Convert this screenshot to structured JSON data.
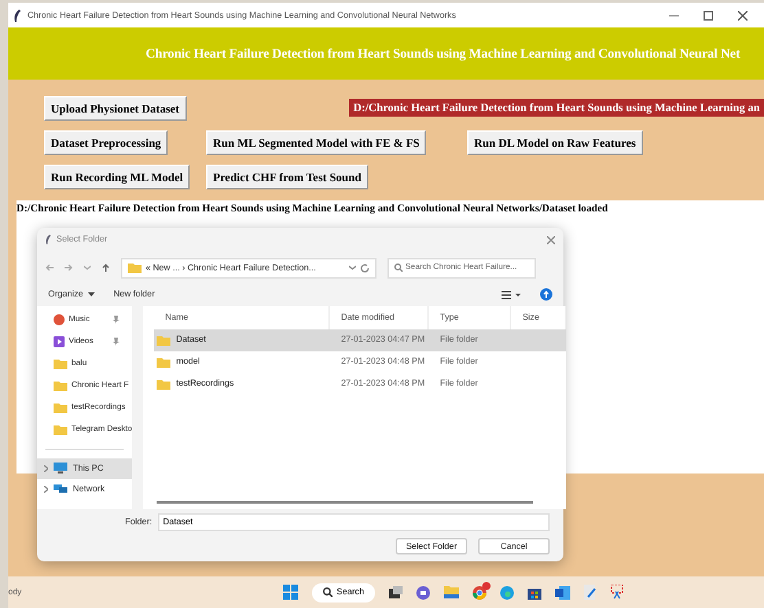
{
  "window": {
    "title": "Chronic Heart Failure Detection from Heart Sounds using Machine Learning and Convolutional Neural Networks"
  },
  "header": {
    "title": "Chronic Heart Failure Detection from Heart Sounds using Machine Learning and Convolutional Neural Net"
  },
  "path_label": "D:/Chronic Heart Failure Detection from Heart Sounds using Machine Learning an",
  "button_rows": [
    [
      "Upload Physionet Dataset"
    ],
    [
      "Dataset Preprocessing",
      "Run ML Segmented Model with FE & FS",
      "Run DL Model on Raw Features"
    ],
    [
      "Run Recording ML Model",
      "Predict CHF from Test Sound"
    ]
  ],
  "output": {
    "lines": [
      "D:/Chronic Heart Failure Detection from Heart Sounds using Machine Learning and Convolutional Neural Networks/Dataset loaded"
    ]
  },
  "dialog": {
    "title": "Select Folder",
    "breadcrumb": "« New ... › Chronic Heart Failure Detection...",
    "search": {
      "placeholder": "Search Chronic Heart Failure..."
    },
    "toolbar": {
      "organize": "Organize",
      "new_folder": "New folder"
    },
    "quick_access": [
      {
        "label": "Music",
        "kind": "music",
        "pinned": true
      },
      {
        "label": "Videos",
        "kind": "video",
        "pinned": true
      },
      {
        "label": "balu",
        "kind": "folder",
        "pinned": false
      },
      {
        "label": "Chronic Heart F",
        "kind": "folder",
        "pinned": false
      },
      {
        "label": "testRecordings",
        "kind": "folder",
        "pinned": false
      },
      {
        "label": "Telegram Deskto",
        "kind": "folder",
        "pinned": false
      }
    ],
    "locations": [
      {
        "label": "This PC",
        "kind": "pc",
        "selected": true
      },
      {
        "label": "Network",
        "kind": "network",
        "selected": false
      }
    ],
    "columns": [
      "Name",
      "Date modified",
      "Type",
      "Size"
    ],
    "rows": [
      {
        "name": "Dataset",
        "date": "27-01-2023 04:47 PM",
        "type": "File folder",
        "selected": true
      },
      {
        "name": "model",
        "date": "27-01-2023 04:48 PM",
        "type": "File folder",
        "selected": false
      },
      {
        "name": "testRecordings",
        "date": "27-01-2023 04:48 PM",
        "type": "File folder",
        "selected": false
      }
    ],
    "folder": {
      "label": "Folder:",
      "value": "Dataset"
    },
    "buttons": [
      "Select Folder",
      "Cancel"
    ]
  },
  "taskbar": {
    "status_text": "ody",
    "search_label": "Search"
  }
}
